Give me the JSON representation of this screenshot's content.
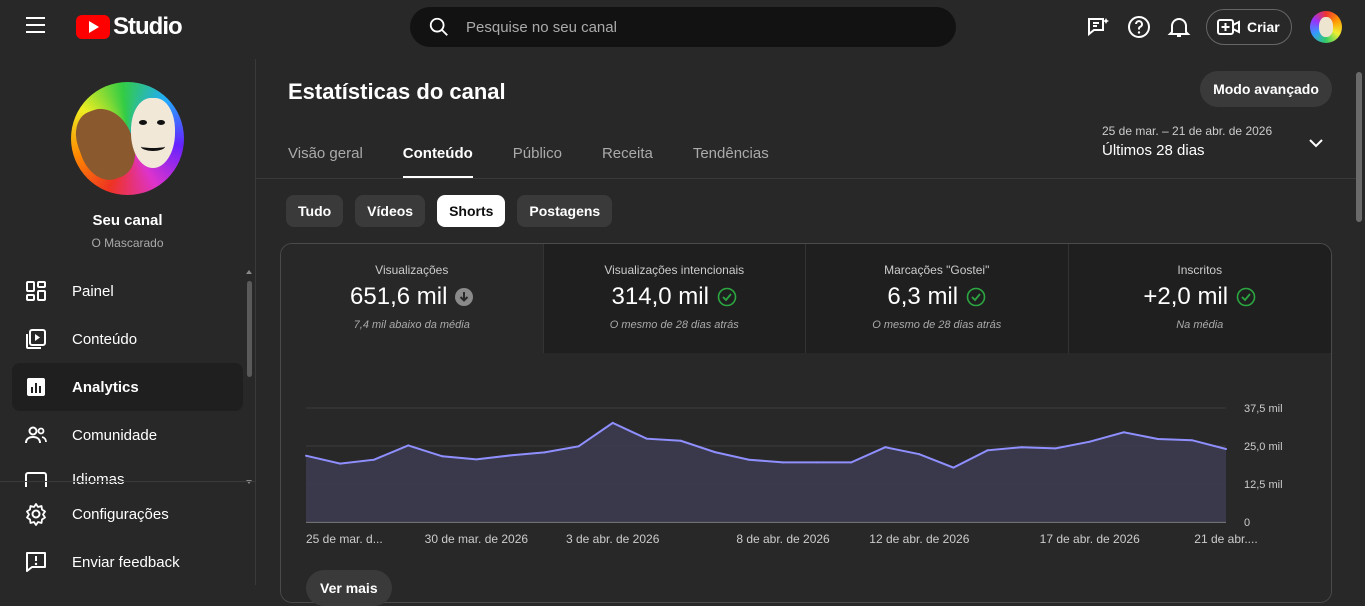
{
  "app": {
    "logo_text": "Studio"
  },
  "search": {
    "placeholder": "Pesquise no seu canal"
  },
  "header": {
    "create_label": "Criar"
  },
  "sidebar": {
    "channel_name": "Seu canal",
    "channel_handle": "O Mascarado",
    "items": [
      {
        "label": "Painel",
        "icon": "dashboard-icon"
      },
      {
        "label": "Conteúdo",
        "icon": "content-icon"
      },
      {
        "label": "Analytics",
        "icon": "analytics-icon"
      },
      {
        "label": "Comunidade",
        "icon": "community-icon"
      },
      {
        "label": "Idiomas",
        "icon": "subtitles-icon"
      }
    ],
    "bottom_items": [
      {
        "label": "Configurações",
        "icon": "gear-icon"
      },
      {
        "label": "Enviar feedback",
        "icon": "feedback-icon"
      }
    ]
  },
  "main": {
    "title": "Estatísticas do canal",
    "advanced_mode": "Modo avançado",
    "tabs": [
      "Visão geral",
      "Conteúdo",
      "Público",
      "Receita",
      "Tendências"
    ],
    "active_tab": 1,
    "date_range": "25 de mar. – 21 de abr. de 2026",
    "date_label": "Últimos 28 dias",
    "chips": [
      "Tudo",
      "Vídeos",
      "Shorts",
      "Postagens"
    ],
    "active_chip": 2,
    "metrics": [
      {
        "label": "Visualizações",
        "value": "651,6 mil",
        "note": "7,4 mil abaixo da média",
        "status": "below"
      },
      {
        "label": "Visualizações intencionais",
        "value": "314,0 mil",
        "note": "O mesmo de 28 dias atrás",
        "status": "ok"
      },
      {
        "label": "Marcações \"Gostei\"",
        "value": "6,3 mil",
        "note": "O mesmo de 28 dias atrás",
        "status": "ok"
      },
      {
        "label": "Inscritos",
        "value": "+2,0 mil",
        "note": "Na média",
        "status": "ok"
      }
    ],
    "see_more": "Ver mais"
  },
  "chart_data": {
    "type": "area",
    "title": "",
    "xlabel": "",
    "ylabel": "",
    "ylim": [
      0,
      37500
    ],
    "y_ticks": [
      "0",
      "12,5 mil",
      "25,0 mil",
      "37,5 mil"
    ],
    "x_tick_labels": [
      "25 de mar. d...",
      "30 de mar. de 2026",
      "3 de abr. de 2026",
      "8 de abr. de 2026",
      "12 de abr. de 2026",
      "17 de abr. de 2026",
      "21 de abr...."
    ],
    "x": [
      "25/03",
      "26/03",
      "27/03",
      "28/03",
      "29/03",
      "30/03",
      "31/03",
      "01/04",
      "02/04",
      "03/04",
      "04/04",
      "05/04",
      "06/04",
      "07/04",
      "08/04",
      "09/04",
      "10/04",
      "11/04",
      "12/04",
      "13/04",
      "14/04",
      "15/04",
      "16/04",
      "17/04",
      "18/04",
      "19/04",
      "20/04",
      "21/04"
    ],
    "values": [
      21800,
      19200,
      20500,
      25200,
      21600,
      20600,
      21900,
      22900,
      24900,
      32600,
      27400,
      26700,
      23000,
      20500,
      19600,
      19600,
      19600,
      24600,
      22300,
      17900,
      23600,
      24600,
      24200,
      26400,
      29500,
      27300,
      26900,
      24000
    ],
    "colors": {
      "line": "#8f8fff",
      "fill": "#3b3b4f",
      "grid": "#3d3d3d"
    }
  }
}
